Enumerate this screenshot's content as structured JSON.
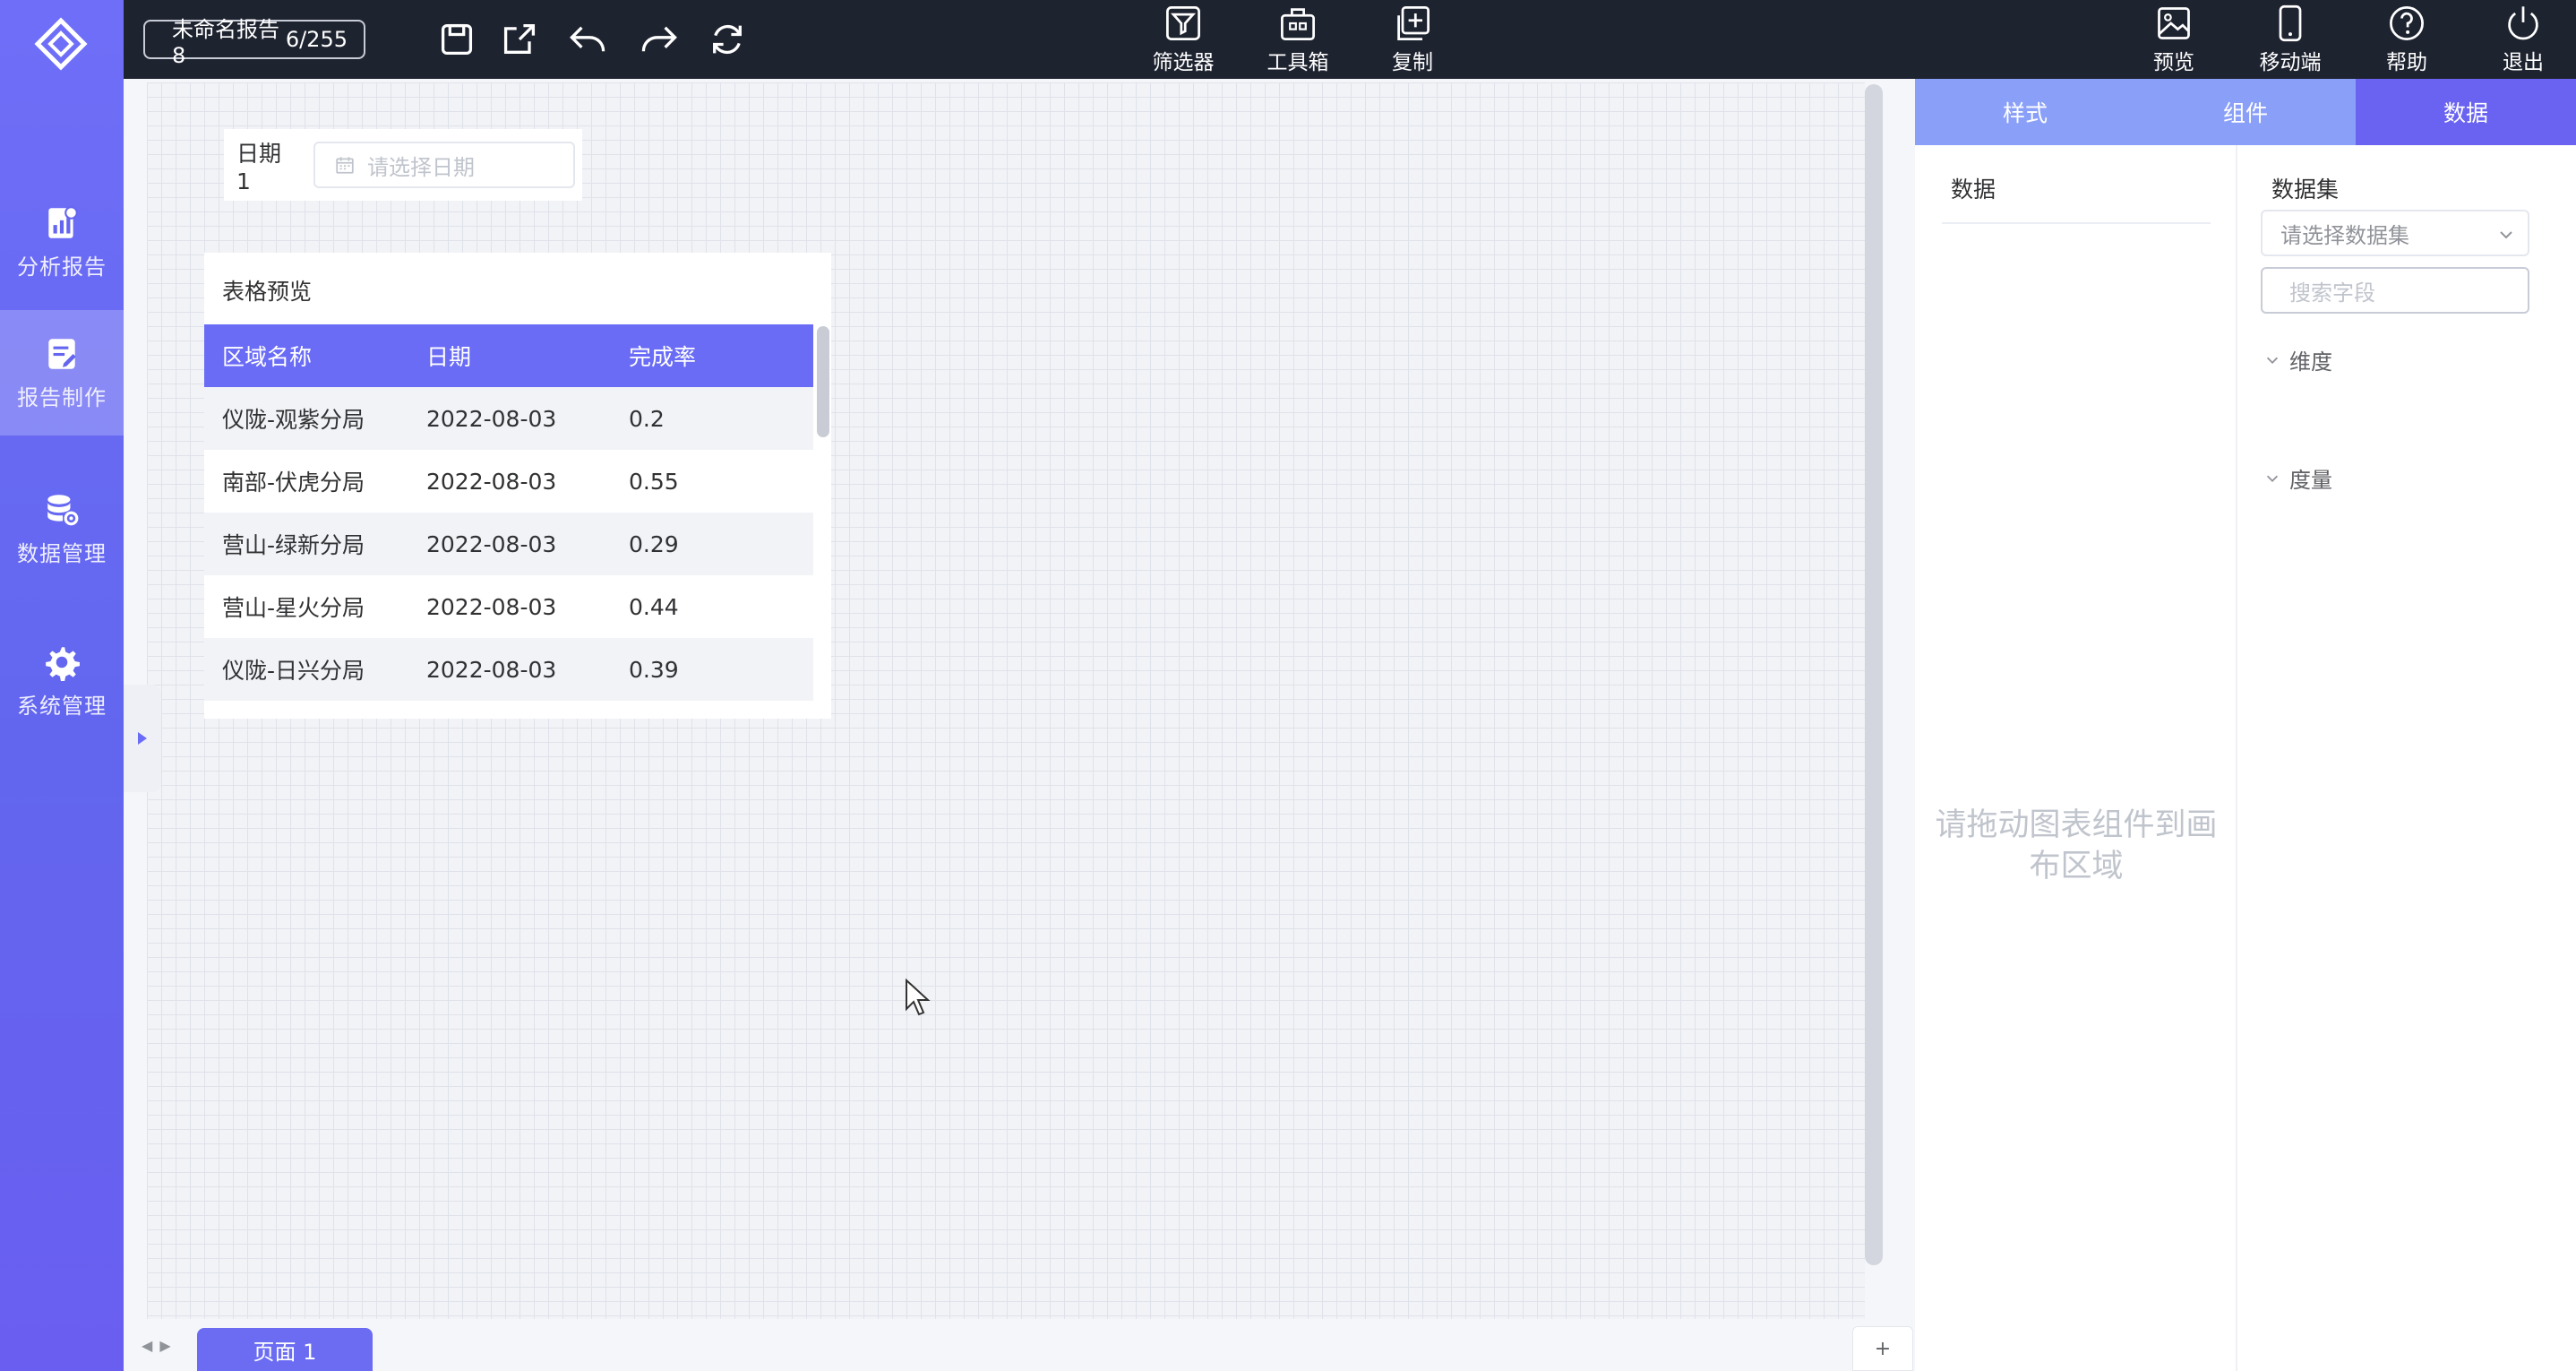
{
  "sidebar": {
    "items": [
      {
        "label": "分析报告",
        "icon": "chart-doc-icon"
      },
      {
        "label": "报告制作",
        "icon": "edit-doc-icon"
      },
      {
        "label": "数据管理",
        "icon": "database-gear-icon"
      },
      {
        "label": "系统管理",
        "icon": "gear-icon"
      }
    ]
  },
  "topbar": {
    "report_name": "未命名报告8",
    "char_count": "6/255",
    "tools": [
      {
        "label": "筛选器",
        "icon": "filter-icon"
      },
      {
        "label": "工具箱",
        "icon": "toolbox-icon"
      },
      {
        "label": "复制",
        "icon": "copy-add-icon"
      }
    ],
    "actions": [
      {
        "label": "预览",
        "icon": "preview-image-icon"
      },
      {
        "label": "移动端",
        "icon": "mobile-icon"
      },
      {
        "label": "帮助",
        "icon": "help-icon"
      },
      {
        "label": "退出",
        "icon": "power-icon"
      }
    ]
  },
  "canvas": {
    "date_filter": {
      "label": "日期1",
      "placeholder": "请选择日期"
    },
    "table": {
      "title": "表格预览",
      "columns": [
        "区域名称",
        "日期",
        "完成率"
      ],
      "rows": [
        [
          "仪陇-观紫分局",
          "2022-08-03",
          "0.2"
        ],
        [
          "南部-伏虎分局",
          "2022-08-03",
          "0.55"
        ],
        [
          "营山-绿新分局",
          "2022-08-03",
          "0.29"
        ],
        [
          "营山-星火分局",
          "2022-08-03",
          "0.44"
        ],
        [
          "仪陇-日兴分局",
          "2022-08-03",
          "0.39"
        ]
      ]
    }
  },
  "pager": {
    "page_tab": "页面 1",
    "add_label": "+"
  },
  "right_panel": {
    "tabs": [
      "样式",
      "组件",
      "数据"
    ],
    "active_tab": "数据",
    "data_col_title": "数据",
    "placeholder": "请拖动图表组件到画布区域",
    "dataset_col_title": "数据集",
    "dataset_select_placeholder": "请选择数据集",
    "search_placeholder": "搜索字段",
    "groups": [
      "维度",
      "度量"
    ]
  },
  "colors": {
    "accent": "#6a6cf6",
    "topbar": "#1e2330",
    "tab_inactive": "#8aa0f8",
    "tab_active": "#6a63f2"
  }
}
